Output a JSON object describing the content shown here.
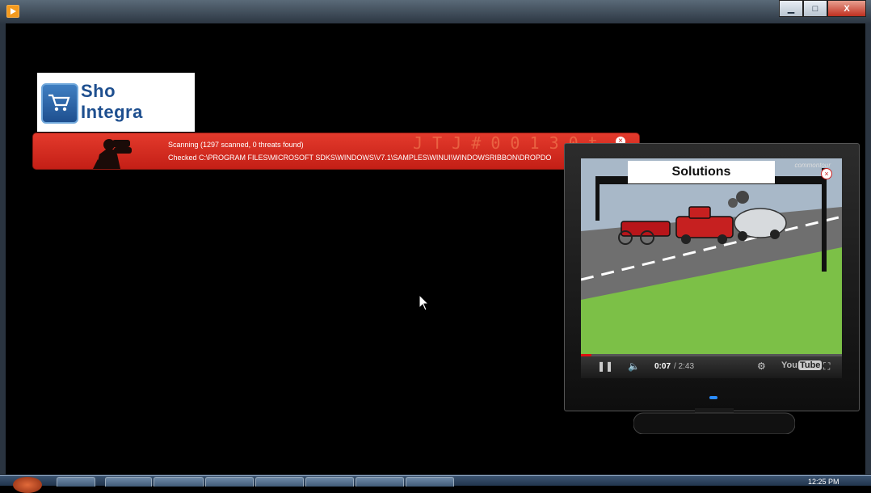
{
  "window": {
    "controls": {
      "minimize": "▁",
      "maximize": "□",
      "close": "X"
    }
  },
  "logo": {
    "line1": "Sho",
    "line2": "Integra"
  },
  "scan_banner": {
    "status": "Scanning (1297 scanned, 0 threats found)",
    "path": "Checked C:\\PROGRAM FILES\\MICROSOFT SDKS\\WINDOWS\\V7.1\\SAMPLES\\WINUI\\WINDOWSRIBBON\\DROPDO",
    "decoration": "J T J # 0 0 1 3 0 t",
    "close": "×"
  },
  "video_player": {
    "overlay_title": "Solutions",
    "brand": "commontour",
    "close": "×",
    "current_time": "0:07",
    "total_time": "/ 2:43",
    "progress": 0.04,
    "logo_you": "You",
    "logo_tube": "Tube",
    "icons": [
      "pause-icon",
      "volume-icon",
      "settings-icon",
      "fullscreen-icon"
    ]
  },
  "taskbar": {
    "clock": "12:25 PM"
  }
}
